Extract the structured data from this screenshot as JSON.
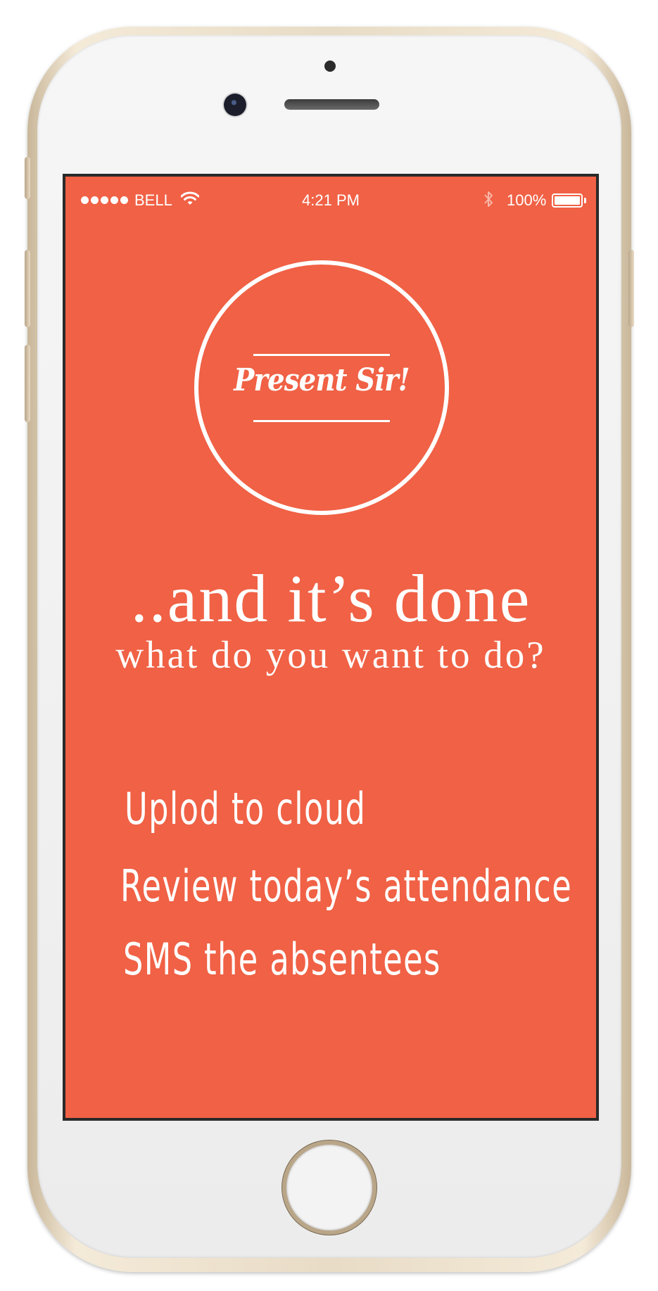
{
  "status_bar": {
    "carrier": "BELL",
    "time": "4:21 PM",
    "battery_percent": "100%",
    "battery_level": 1.0,
    "signal_bars": 5,
    "icons": [
      "signal-icon",
      "wifi-icon",
      "bluetooth-icon",
      "battery-icon"
    ]
  },
  "logo": {
    "text": "Present Sir!"
  },
  "main": {
    "headline": "..and it’s done",
    "subheadline": "what do you want to do?"
  },
  "actions": [
    {
      "label": "Uplod to cloud"
    },
    {
      "label": "Review today’s attendance"
    },
    {
      "label": "SMS the absentees"
    }
  ],
  "colors": {
    "screen_background": "#f06145",
    "foreground": "#ffffff",
    "device_frame": "#e8dcc6"
  }
}
